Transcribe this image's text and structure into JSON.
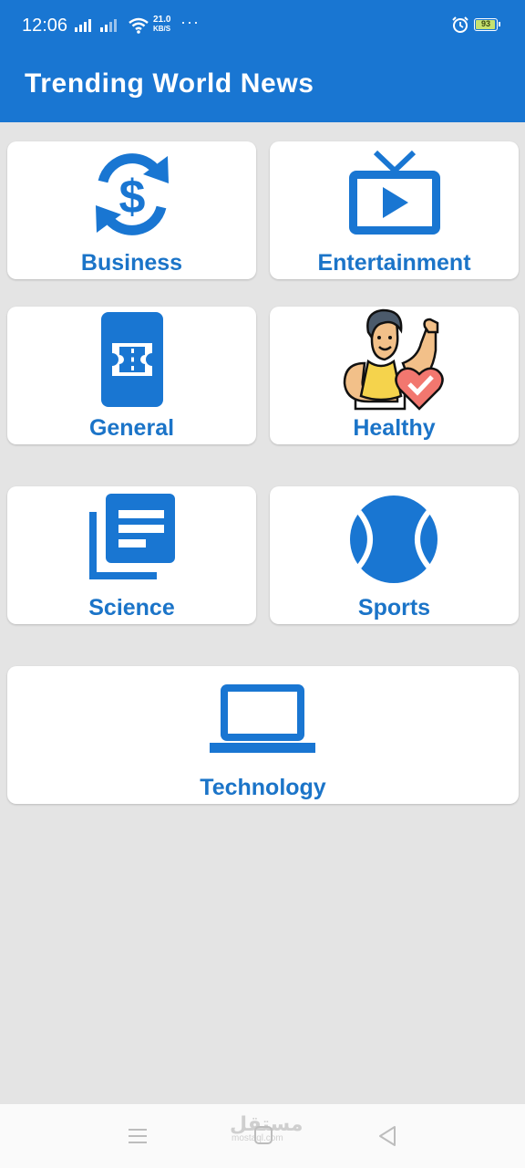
{
  "status_bar": {
    "time": "12:06",
    "speed_value": "21.0",
    "speed_unit": "KB/S",
    "more_indicator": "···",
    "battery": "93",
    "icons": [
      "signal-icon",
      "signal-icon",
      "wifi-icon",
      "alarm-icon",
      "battery-icon"
    ]
  },
  "app_bar": {
    "title": "Trending World News"
  },
  "categories": [
    {
      "label": "Business",
      "icon": "currency-exchange-icon"
    },
    {
      "label": "Entertainment",
      "icon": "tv-icon"
    },
    {
      "label": "General",
      "icon": "ticket-phone-icon"
    },
    {
      "label": "Healthy",
      "icon": "fitness-person-icon"
    },
    {
      "label": "Science",
      "icon": "library-books-icon"
    },
    {
      "label": "Sports",
      "icon": "tennis-ball-icon"
    },
    {
      "label": "Technology",
      "icon": "laptop-icon"
    }
  ],
  "nav_bar": {
    "icons": [
      "menu-icon",
      "home-icon",
      "back-icon"
    ]
  },
  "watermark": {
    "arabic": "مستقل",
    "domain": "mostaql.com"
  },
  "colors": {
    "primary": "#1976d2",
    "label": "#1b74c8",
    "background": "#e4e4e4",
    "card": "#ffffff"
  }
}
